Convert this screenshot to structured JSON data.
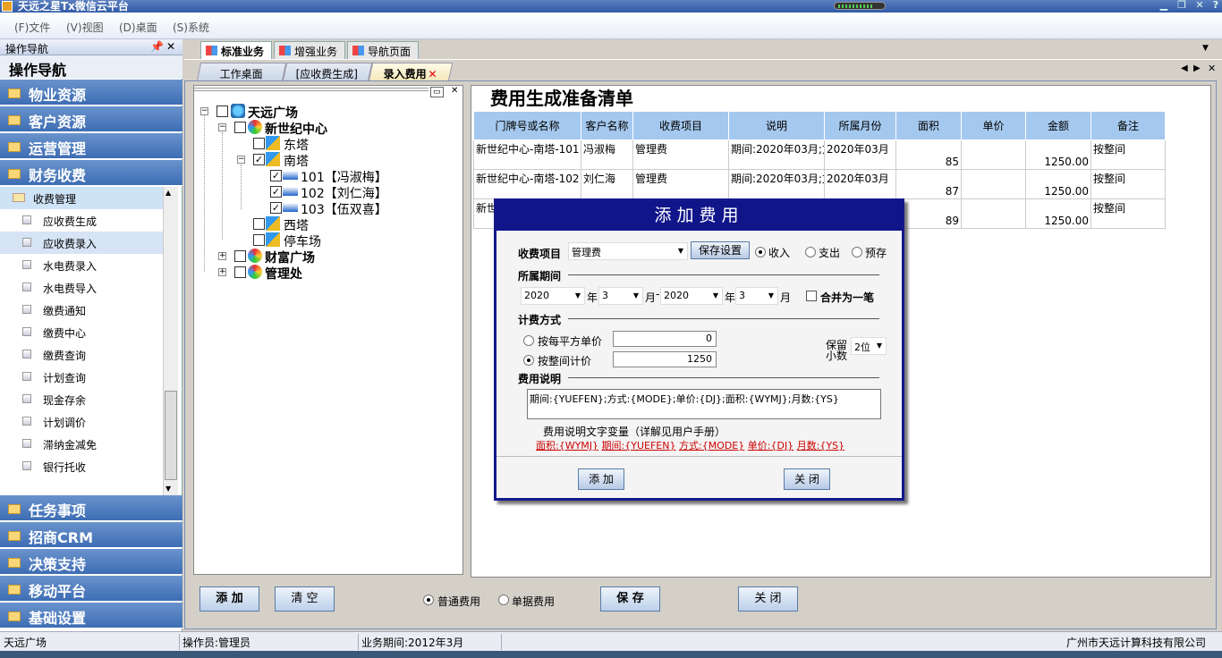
{
  "window": {
    "title": "天远之星Tx微信云平台"
  },
  "menu": [
    "(F)文件",
    "(V)视图",
    "(D)桌面",
    "(S)系统"
  ],
  "sidebar": {
    "header": "操作导航",
    "title": "操作导航",
    "categories_top": [
      "物业资源",
      "客户资源",
      "运营管理",
      "财务收费"
    ],
    "sub_header": "收费管理",
    "sub_items": [
      "应收费生成",
      "应收费录入",
      "水电费录入",
      "水电费导入",
      "缴费通知",
      "缴费中心",
      "缴费查询",
      "计划查询",
      "现金存余",
      "计划调价",
      "滞纳金减免",
      "银行托收"
    ],
    "categories_bottom": [
      "任务事项",
      "招商CRM",
      "决策支持",
      "移动平台",
      "基础设置"
    ]
  },
  "tabs_top": [
    "标准业务",
    "增强业务",
    "导航页面"
  ],
  "tabs_doc": [
    "工作桌面",
    "[应收费生成]",
    "录入费用"
  ],
  "tree": {
    "root": "天远广场",
    "n1": "新世纪中心",
    "east": "东塔",
    "south": "南塔",
    "r101": "101【冯淑梅】",
    "r102": "102【刘仁海】",
    "r103": "103【伍双喜】",
    "west": "西塔",
    "parking": "停车场",
    "n2": "财富广场",
    "n3": "管理处"
  },
  "list": {
    "title": "费用生成准备清单",
    "columns": [
      "门牌号或名称",
      "客户名称",
      "收费项目",
      "说明",
      "所属月份",
      "面积",
      "单价",
      "金额",
      "备注"
    ],
    "rows": [
      [
        "新世纪中心-南塔-101",
        "冯淑梅",
        "管理费",
        "期间:2020年03月;方",
        "2020年03月",
        "85",
        "",
        "1250.00",
        "按整间"
      ],
      [
        "新世纪中心-南塔-102",
        "刘仁海",
        "管理费",
        "期间:2020年03月;方",
        "2020年03月",
        "87",
        "",
        "1250.00",
        "按整间"
      ],
      [
        "新世",
        "",
        "",
        "",
        "",
        "89",
        "",
        "1250.00",
        "按整间"
      ]
    ]
  },
  "bottom": {
    "add": "添 加",
    "clear": "清 空",
    "radio1": "普通费用",
    "radio2": "单据费用",
    "save": "保 存",
    "close": "关 闭"
  },
  "dialog": {
    "title": "添加费用",
    "item_label": "收费项目",
    "item_value": "管理费",
    "save_setting": "保存设置",
    "r_income": "收入",
    "r_expense": "支出",
    "r_prepay": "预存",
    "period_label": "所属期间",
    "year1": "2020",
    "month1": "3",
    "year2": "2020",
    "month2": "3",
    "year_unit": "年",
    "month_unit": "月",
    "dash": "-",
    "merge": "合并为一笔",
    "calc_label": "计费方式",
    "by_sqm": "按每平方单价",
    "sqm_value": "0",
    "by_room": "按整间计价",
    "room_value": "1250",
    "keep": "保留",
    "decimals": "小数",
    "decimal_value": "2位",
    "desc_label": "费用说明",
    "desc_value": "期间:{YUEFEN};方式:{MODE};单价:{DJ};面积:{WYMJ};月数:{YS}",
    "vars_note": "费用说明文字变量（详解见用户手册）",
    "vars": [
      "面积:{WYMJ}",
      "期间:{YUEFEN}",
      "方式:{MODE}",
      "单价:{DJ}",
      "月数:{YS}"
    ],
    "add_btn": "添 加",
    "close_btn": "关 闭"
  },
  "status": {
    "company": "天远广场",
    "operator": "操作员:管理员",
    "period": "业务期间:2012年3月",
    "vendor": "广州市天远计算科技有限公司"
  }
}
